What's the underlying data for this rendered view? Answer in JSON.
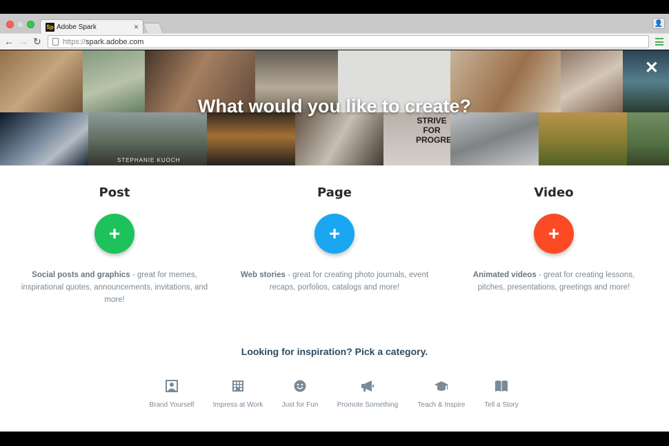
{
  "browser": {
    "tab_title": "Adobe Spark",
    "favicon_text": "Sp",
    "url_protocol": "https://",
    "url_host": "spark.adobe.com"
  },
  "hero": {
    "title": "What would you like to create?",
    "tile_caption": "STEPHANIE KUOCH",
    "strive_text": "STRIVE FOR PROGRESS"
  },
  "options": [
    {
      "title": "Post",
      "color": "#1dc35a",
      "desc_bold": "Social posts and graphics",
      "desc_rest": " - great for memes, inspirational quotes, announcements, invitations, and more!"
    },
    {
      "title": "Page",
      "color": "#1aa6f0",
      "desc_bold": "Web stories",
      "desc_rest": " - great for creating photo journals, event recaps, porfolios, catalogs and more!"
    },
    {
      "title": "Video",
      "color": "#fb4a24",
      "desc_bold": "Animated videos",
      "desc_rest": " - great for creating lessons, pitches, presentations, greetings and more!"
    }
  ],
  "inspiration": {
    "heading": "Looking for inspiration? Pick a category.",
    "categories": [
      {
        "label": "Brand Yourself",
        "icon": "portrait-icon"
      },
      {
        "label": "Impress at Work",
        "icon": "building-icon"
      },
      {
        "label": "Just for Fun",
        "icon": "smiley-icon"
      },
      {
        "label": "Promote Something",
        "icon": "megaphone-icon"
      },
      {
        "label": "Teach & Inspire",
        "icon": "graduation-cap-icon"
      },
      {
        "label": "Tell a Story",
        "icon": "book-icon"
      }
    ]
  }
}
